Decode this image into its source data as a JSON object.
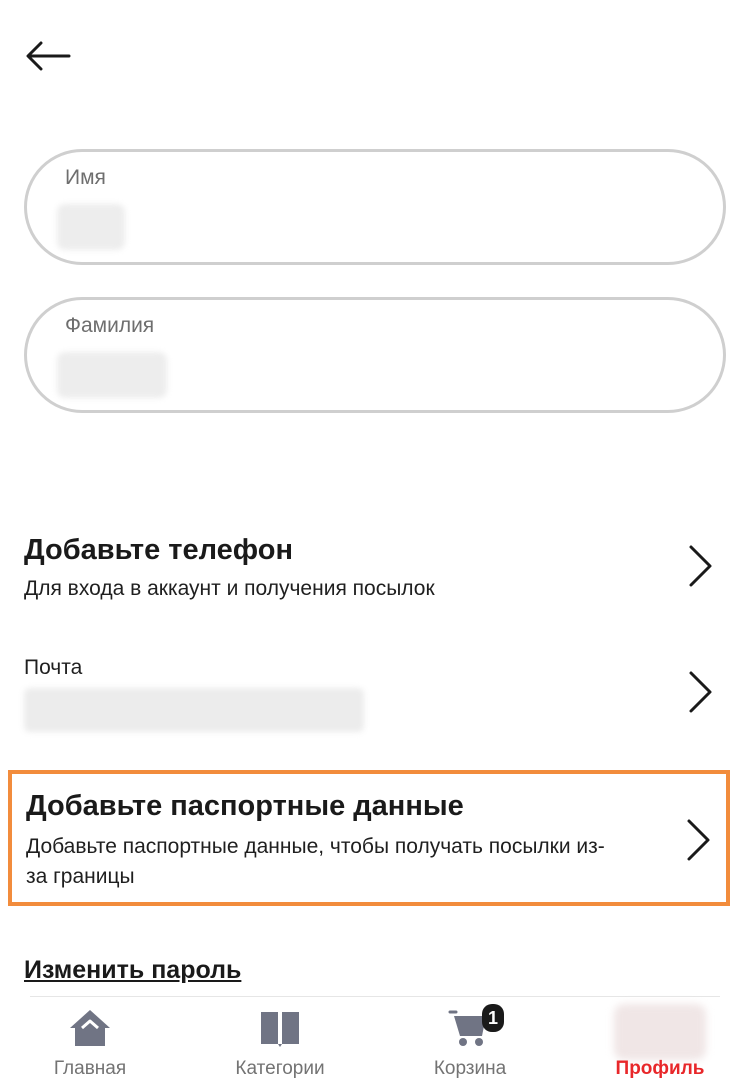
{
  "header": {
    "back_icon": "arrow-left-icon"
  },
  "fields": {
    "first_name": {
      "label": "Имя"
    },
    "last_name": {
      "label": "Фамилия"
    }
  },
  "phone": {
    "title": "Добавьте телефон",
    "subtitle": "Для входа в аккаунт и получения посылок"
  },
  "email": {
    "label": "Почта"
  },
  "passport": {
    "title": "Добавьте паспортные данные",
    "subtitle": "Добавьте паспортные данные, чтобы получать посылки из-за границы"
  },
  "change_password": "Изменить пароль",
  "tabbar": {
    "home": "Главная",
    "categories": "Категории",
    "cart": "Корзина",
    "cart_badge": "1",
    "profile": "Профиль"
  },
  "colors": {
    "accent": "#e8272a",
    "highlight_border": "#f28c3c",
    "icon_gray": "#707484"
  }
}
